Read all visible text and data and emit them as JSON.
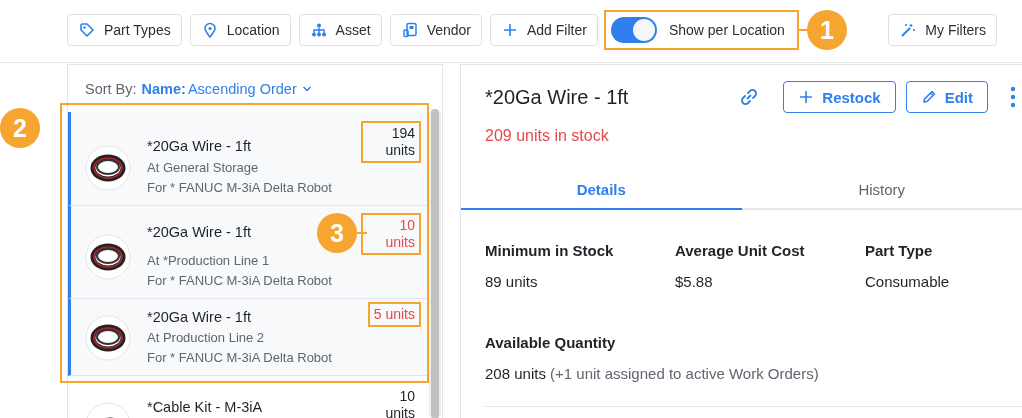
{
  "toolbar": {
    "filters": [
      {
        "label": "Part Types",
        "kind": "tag"
      },
      {
        "label": "Location",
        "kind": "pin"
      },
      {
        "label": "Asset",
        "kind": "tree"
      },
      {
        "label": "Vendor",
        "kind": "vendor"
      },
      {
        "label": "Add Filter",
        "kind": "plus"
      }
    ],
    "toggle": {
      "label": "Show per Location",
      "on": true,
      "highlighted": true
    },
    "my_filters": {
      "label": "My Filters"
    }
  },
  "list": {
    "sort_label": "Sort By:",
    "sort_field": "Name:",
    "sort_order": "Ascending Order",
    "highlighted": true,
    "rows": [
      {
        "name": "*20Ga Wire - 1ft",
        "location": "At General Storage",
        "asset": "For * FANUC M-3iA Delta Robot",
        "quantity": "194 units",
        "low": false,
        "selected": true,
        "highlighted": true,
        "kind": "wire"
      },
      {
        "name": "*20Ga Wire - 1ft",
        "location": "At *Production Line 1",
        "asset": "For * FANUC M-3iA Delta Robot",
        "quantity": "10 units",
        "low": true,
        "selected": true,
        "highlighted": true,
        "kind": "wire"
      },
      {
        "name": "*20Ga Wire - 1ft",
        "location": "At Production Line 2",
        "asset": "For * FANUC M-3iA Delta Robot",
        "quantity": "5 units",
        "low": true,
        "selected": true,
        "highlighted": true,
        "kind": "wire"
      },
      {
        "name": "*Cable Kit - M-3iA",
        "quantity": "10 units",
        "low": false,
        "selected": false,
        "highlighted": false,
        "kind": "cable"
      }
    ]
  },
  "detail": {
    "title": "*20Ga Wire - 1ft",
    "stock": "209 units in stock",
    "stock_low": true,
    "buttons": [
      {
        "label": "Restock",
        "kind": "plus"
      },
      {
        "label": "Edit",
        "kind": "pencil"
      }
    ],
    "tabs": [
      {
        "label": "Details",
        "selected": true
      },
      {
        "label": "History",
        "selected": false
      }
    ],
    "fields": [
      {
        "label": "Minimum in Stock",
        "value": "89 units"
      },
      {
        "label": "Average Unit Cost",
        "value": "$5.88"
      },
      {
        "label": "Part Type",
        "value": "Consumable"
      }
    ],
    "available": {
      "label": "Available Quantity",
      "value": "208 units",
      "note": "(+1 unit assigned to active Work Orders)"
    }
  },
  "callouts": [
    {
      "label": "1"
    },
    {
      "label": "2"
    },
    {
      "label": "3"
    }
  ]
}
